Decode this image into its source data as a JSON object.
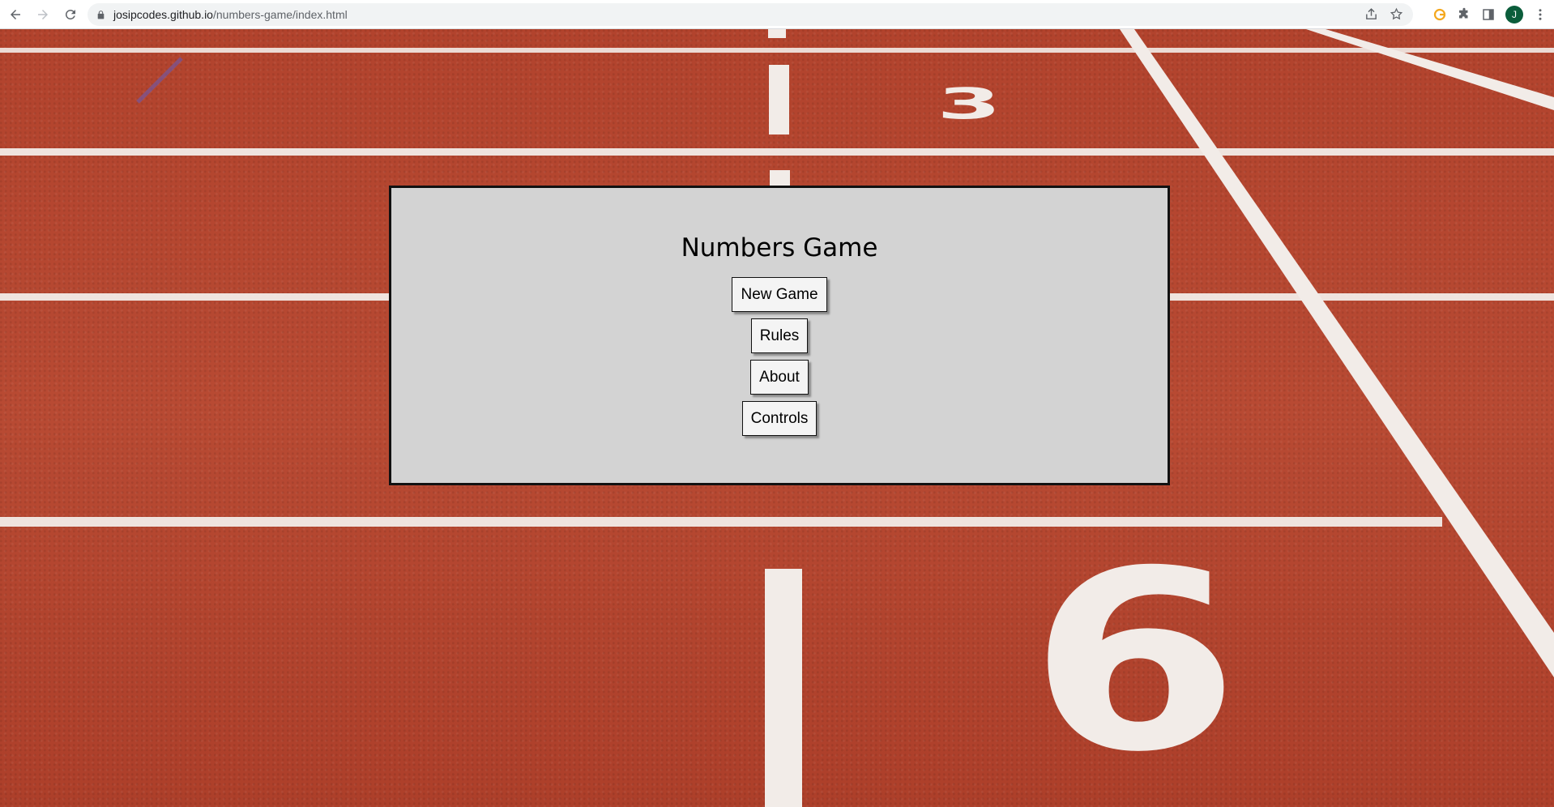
{
  "browser": {
    "url_domain": "josipcodes.github.io",
    "url_path": "/numbers-game/index.html",
    "profile_initial": "J"
  },
  "track": {
    "lane_numbers": [
      "3",
      "6"
    ]
  },
  "menu": {
    "title": "Numbers Game",
    "buttons": [
      {
        "label": "New Game"
      },
      {
        "label": "Rules"
      },
      {
        "label": "About"
      },
      {
        "label": "Controls"
      }
    ]
  },
  "colors": {
    "track": "#b5452f",
    "panel": "#d3d3d3",
    "lines": "#ffffff"
  }
}
